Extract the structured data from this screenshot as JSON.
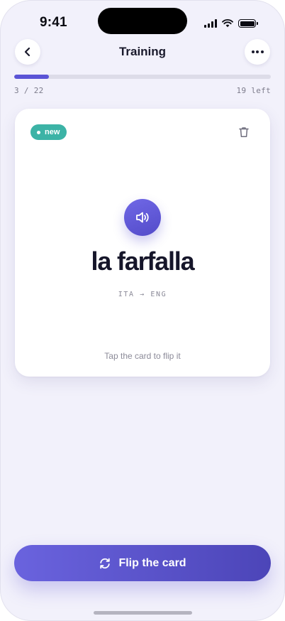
{
  "status_bar": {
    "time": "9:41"
  },
  "header": {
    "title": "Training"
  },
  "progress": {
    "current_label": "3 / 22",
    "remaining_label": "19 left",
    "fraction": 0.136
  },
  "card": {
    "badge": "new",
    "word": "la farfalla",
    "language_pair": "ITA → ENG",
    "hint": "Tap the card to flip it"
  },
  "actions": {
    "flip_label": "Flip the card"
  },
  "icons": {
    "back": "chevron-left-icon",
    "more": "more-horizontal-icon",
    "delete": "trash-icon",
    "audio": "speaker-icon",
    "flip": "refresh-icon"
  },
  "colors": {
    "accent": "#5b54d6",
    "badge_new": "#3cb3a6",
    "background": "#f2f1fb"
  }
}
